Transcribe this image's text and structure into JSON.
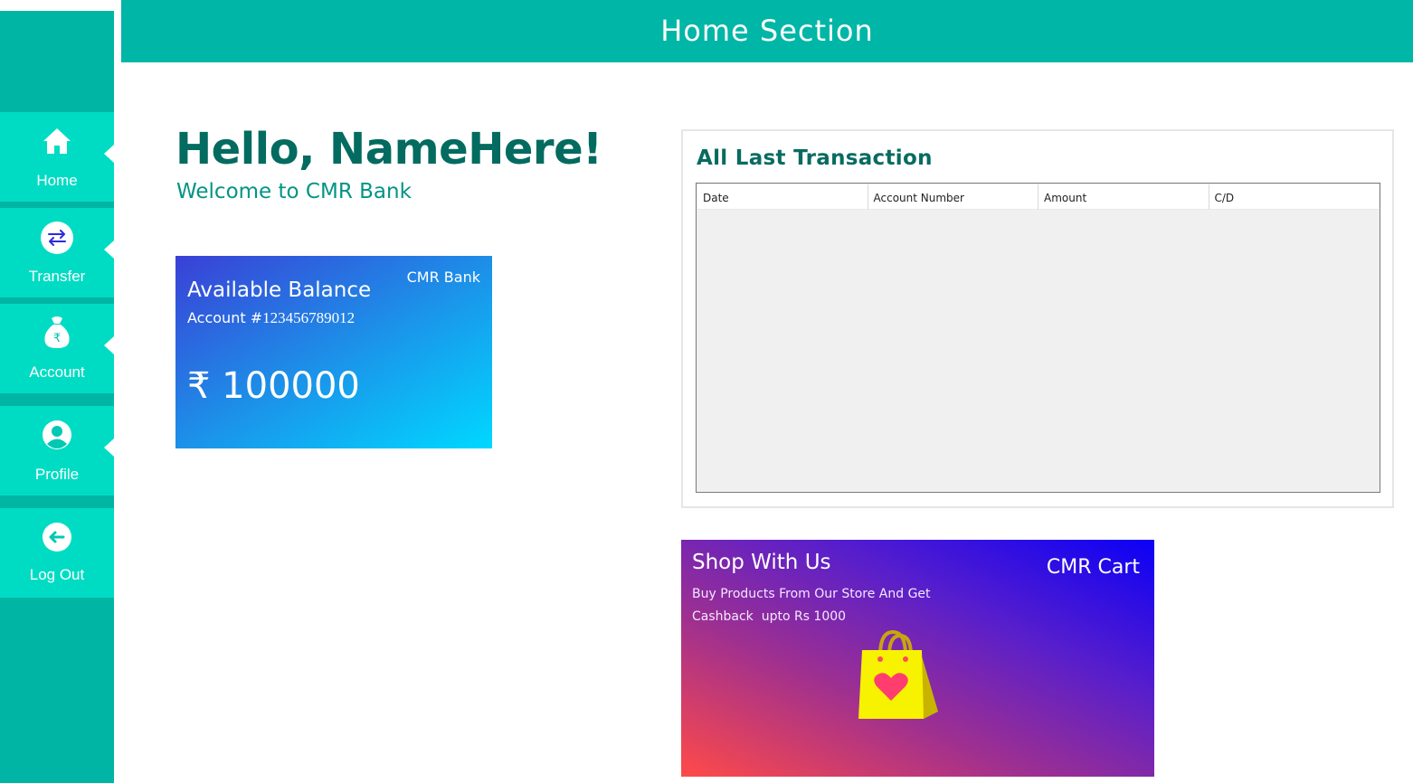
{
  "header": {
    "title": "Home Section"
  },
  "sidebar": {
    "items": [
      {
        "label": "Home",
        "icon": "home-icon"
      },
      {
        "label": "Transfer",
        "icon": "transfer-icon"
      },
      {
        "label": "Account",
        "icon": "money-bag-icon"
      },
      {
        "label": "Profile",
        "icon": "user-icon"
      },
      {
        "label": "Log Out",
        "icon": "logout-icon"
      }
    ]
  },
  "greeting": {
    "title": "Hello, NameHere!",
    "subtitle": "Welcome to CMR Bank"
  },
  "balance_card": {
    "bank": "CMR Bank",
    "title": "Available Balance",
    "account_label": "Account #",
    "account_number": "123456789012",
    "amount": "₹ 100000"
  },
  "transactions": {
    "title": "All Last Transaction",
    "columns": [
      "Date",
      "Account Number",
      "Amount",
      "C/D"
    ],
    "rows": []
  },
  "shop": {
    "title": "Shop With Us",
    "brand": "CMR Cart",
    "line1": "Buy Products From Our Store And Get",
    "line2": "Cashback  upto Rs 1000"
  },
  "colors": {
    "sidebar": "#00b5a3",
    "nav_item": "#00dcc3",
    "header": "#00b6a6",
    "greeting": "#036b5f",
    "bag": "#f7f200",
    "heart": "#ff3d6e"
  }
}
